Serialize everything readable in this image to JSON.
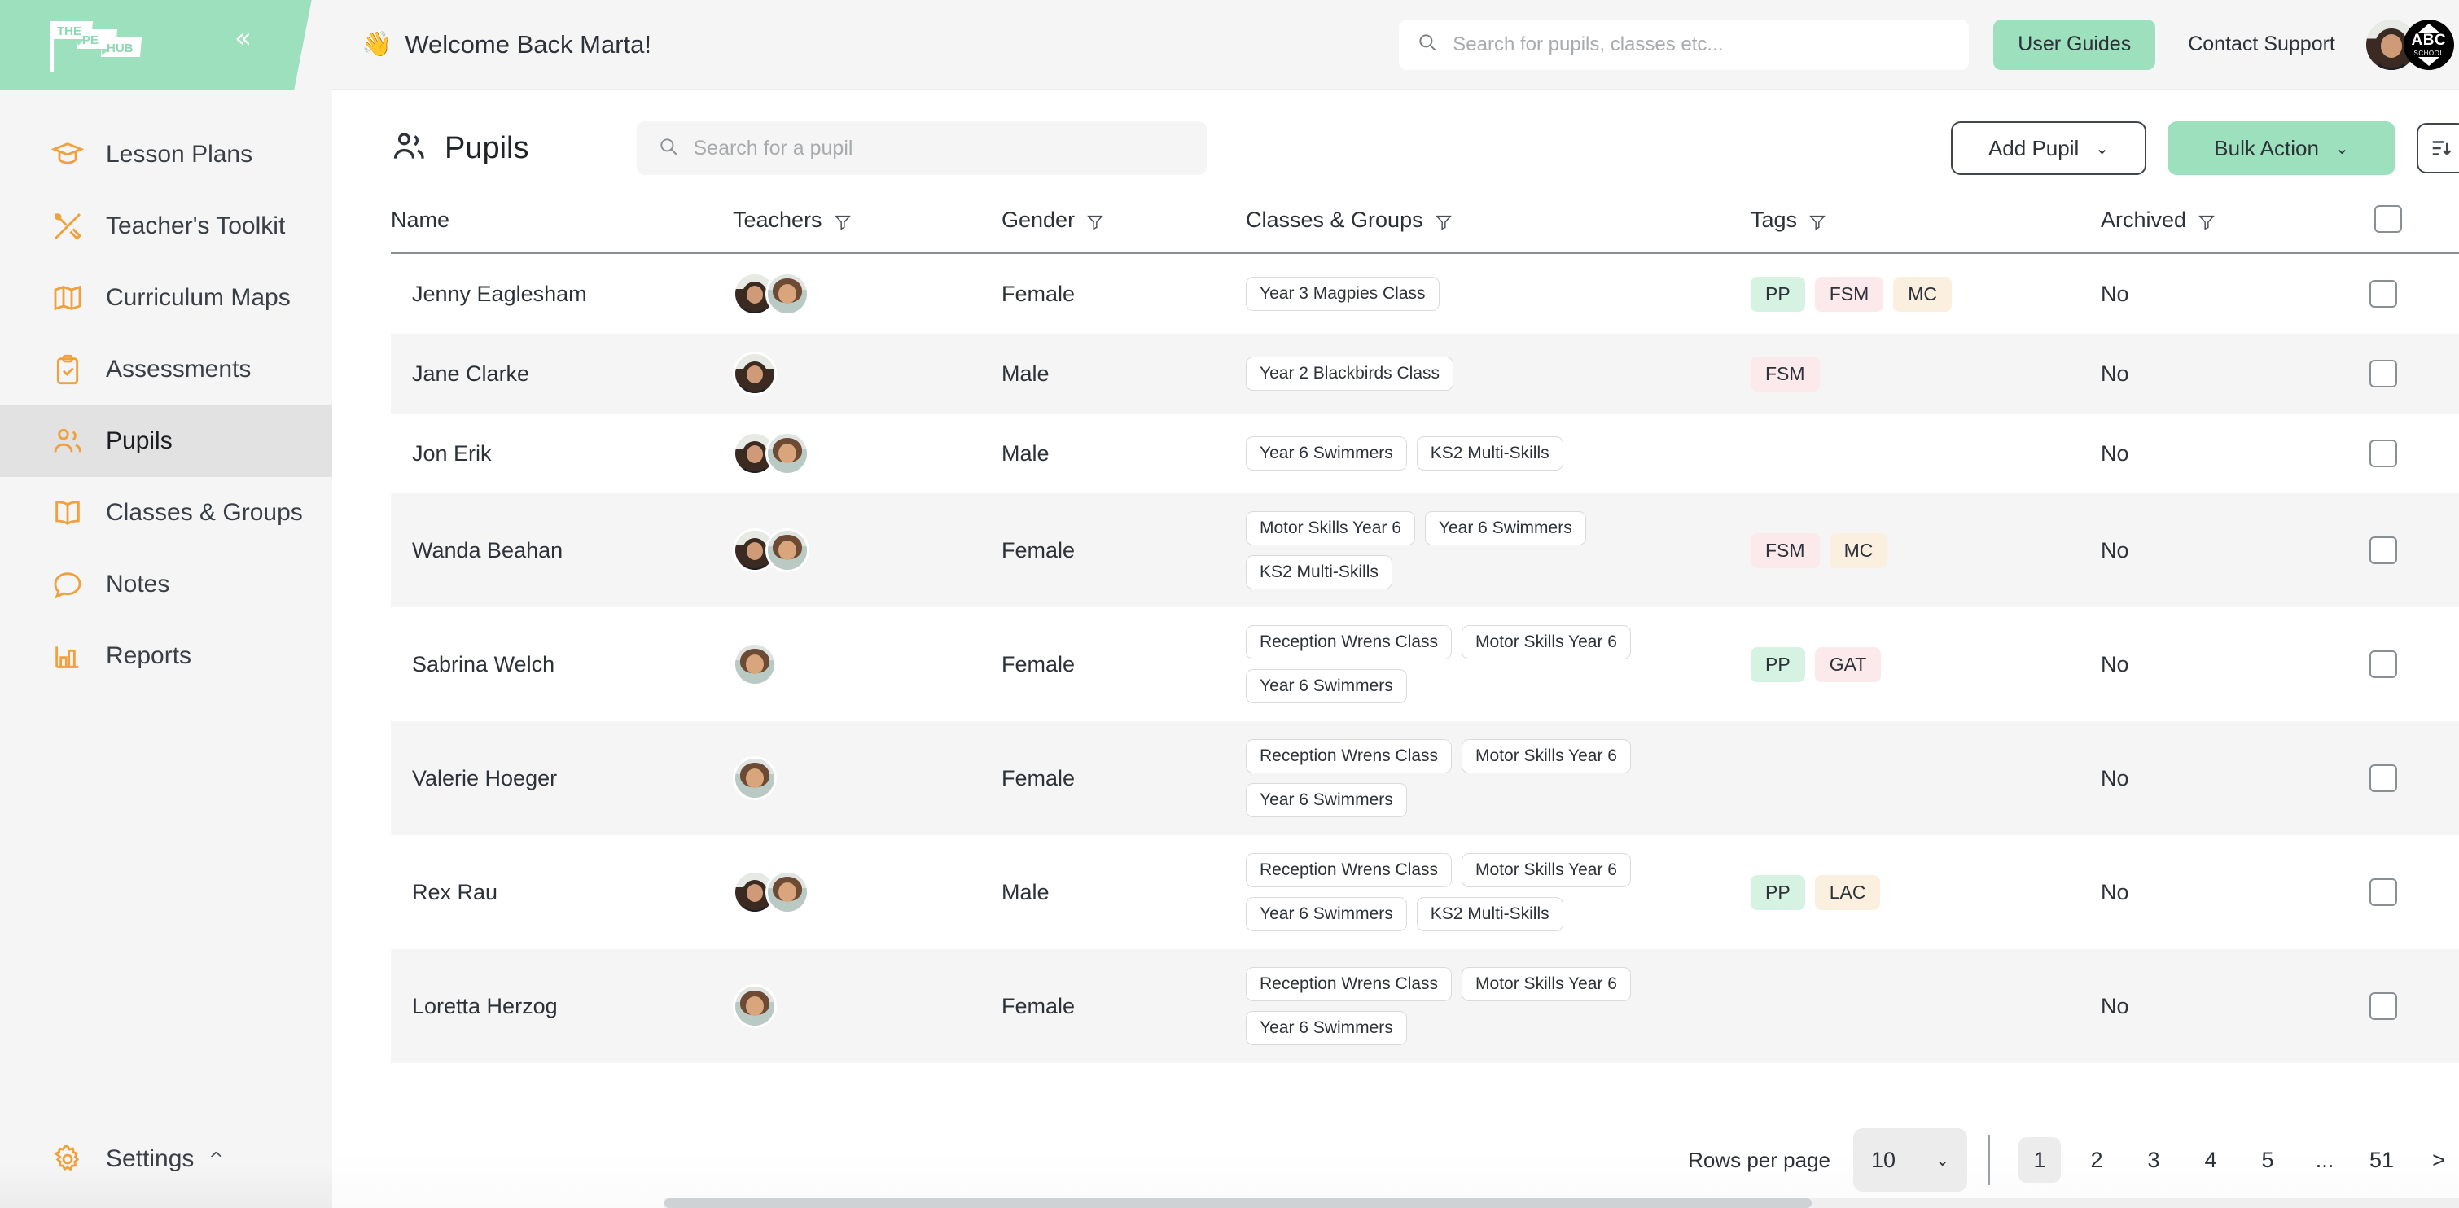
{
  "brand": {
    "logo_text_1": "THE",
    "logo_text_2": "PE",
    "logo_text_3": "HUB",
    "accent_green": "#9ce0bd",
    "accent_orange": "#f0a03c"
  },
  "topbar": {
    "wave_emoji": "👋",
    "welcome": "Welcome Back Marta!",
    "search_placeholder": "Search for pupils, classes etc...",
    "search_value": "",
    "user_guides_label": "User Guides",
    "contact_support_label": "Contact Support",
    "school_badge_text": "ABC",
    "school_badge_sub": "SCHOOL"
  },
  "sidebar": {
    "items": [
      {
        "label": "Lesson Plans",
        "icon": "graduation-cap-icon",
        "active": false
      },
      {
        "label": "Teacher's Toolkit",
        "icon": "tools-icon",
        "active": false
      },
      {
        "label": "Curriculum Maps",
        "icon": "map-icon",
        "active": false
      },
      {
        "label": "Assessments",
        "icon": "clipboard-check-icon",
        "active": false
      },
      {
        "label": "Pupils",
        "icon": "users-icon",
        "active": true
      },
      {
        "label": "Classes & Groups",
        "icon": "book-icon",
        "active": false
      },
      {
        "label": "Notes",
        "icon": "chat-bubble-icon",
        "active": false
      },
      {
        "label": "Reports",
        "icon": "bar-chart-icon",
        "active": false
      }
    ],
    "settings_label": "Settings"
  },
  "page": {
    "title": "Pupils",
    "search_placeholder": "Search for a pupil",
    "search_value": "",
    "add_pupil_label": "Add Pupil",
    "bulk_action_label": "Bulk Action"
  },
  "table": {
    "columns": [
      {
        "label": "Name",
        "filter": false
      },
      {
        "label": "Teachers",
        "filter": true
      },
      {
        "label": "Gender",
        "filter": true
      },
      {
        "label": "Classes & Groups",
        "filter": true
      },
      {
        "label": "Tags",
        "filter": true
      },
      {
        "label": "Archived",
        "filter": true
      },
      {
        "label": "",
        "filter": false
      }
    ],
    "rows": [
      {
        "name": "Jenny Eaglesham",
        "teachers": [
          "f1",
          "f2"
        ],
        "gender": "Female",
        "classes": [
          "Year 3 Magpies Class"
        ],
        "tags": [
          {
            "label": "PP",
            "color": "green"
          },
          {
            "label": "FSM",
            "color": "pink"
          },
          {
            "label": "MC",
            "color": "cream"
          }
        ],
        "archived": "No",
        "checked": false
      },
      {
        "name": "Jane Clarke",
        "teachers": [
          "f1"
        ],
        "gender": "Male",
        "classes": [
          "Year 2 Blackbirds Class"
        ],
        "tags": [
          {
            "label": "FSM",
            "color": "pink"
          }
        ],
        "archived": "No",
        "checked": false
      },
      {
        "name": "Jon Erik",
        "teachers": [
          "f1",
          "f2"
        ],
        "gender": "Male",
        "classes": [
          "Year 6 Swimmers",
          "KS2 Multi-Skills"
        ],
        "tags": [],
        "archived": "No",
        "checked": false
      },
      {
        "name": "Wanda Beahan",
        "teachers": [
          "f1",
          "f2"
        ],
        "gender": "Female",
        "classes": [
          "Motor Skills Year 6",
          "Year 6 Swimmers",
          "KS2 Multi-Skills"
        ],
        "tags": [
          {
            "label": "FSM",
            "color": "pink"
          },
          {
            "label": "MC",
            "color": "cream"
          }
        ],
        "archived": "No",
        "checked": false
      },
      {
        "name": "Sabrina Welch",
        "teachers": [
          "f2"
        ],
        "gender": "Female",
        "classes": [
          "Reception Wrens Class",
          "Motor Skills Year 6",
          "Year 6 Swimmers"
        ],
        "tags": [
          {
            "label": "PP",
            "color": "green"
          },
          {
            "label": "GAT",
            "color": "pink"
          }
        ],
        "archived": "No",
        "checked": false
      },
      {
        "name": "Valerie Hoeger",
        "teachers": [
          "f2"
        ],
        "gender": "Female",
        "classes": [
          "Reception Wrens Class",
          "Motor Skills Year 6",
          "Year 6 Swimmers"
        ],
        "tags": [],
        "archived": "No",
        "checked": false
      },
      {
        "name": "Rex Rau",
        "teachers": [
          "f1",
          "f2"
        ],
        "gender": "Male",
        "classes": [
          "Reception Wrens Class",
          "Motor Skills Year 6",
          "Year 6 Swimmers",
          "KS2 Multi-Skills"
        ],
        "tags": [
          {
            "label": "PP",
            "color": "green"
          },
          {
            "label": "LAC",
            "color": "cream"
          }
        ],
        "archived": "No",
        "checked": false
      },
      {
        "name": "Loretta Herzog",
        "teachers": [
          "f2"
        ],
        "gender": "Female",
        "classes": [
          "Reception Wrens Class",
          "Motor Skills Year 6",
          "Year 6 Swimmers"
        ],
        "tags": [],
        "archived": "No",
        "checked": false
      }
    ]
  },
  "tag_colors": {
    "green": "#d6f2e3",
    "pink": "#fbe9ec",
    "cream": "#fbf0e0"
  },
  "pagination": {
    "rows_label": "Rows per page",
    "rows_value": "10",
    "pages": [
      "1",
      "2",
      "3",
      "4",
      "5",
      "...",
      "51"
    ],
    "active_page": "1",
    "next_label": ">"
  }
}
